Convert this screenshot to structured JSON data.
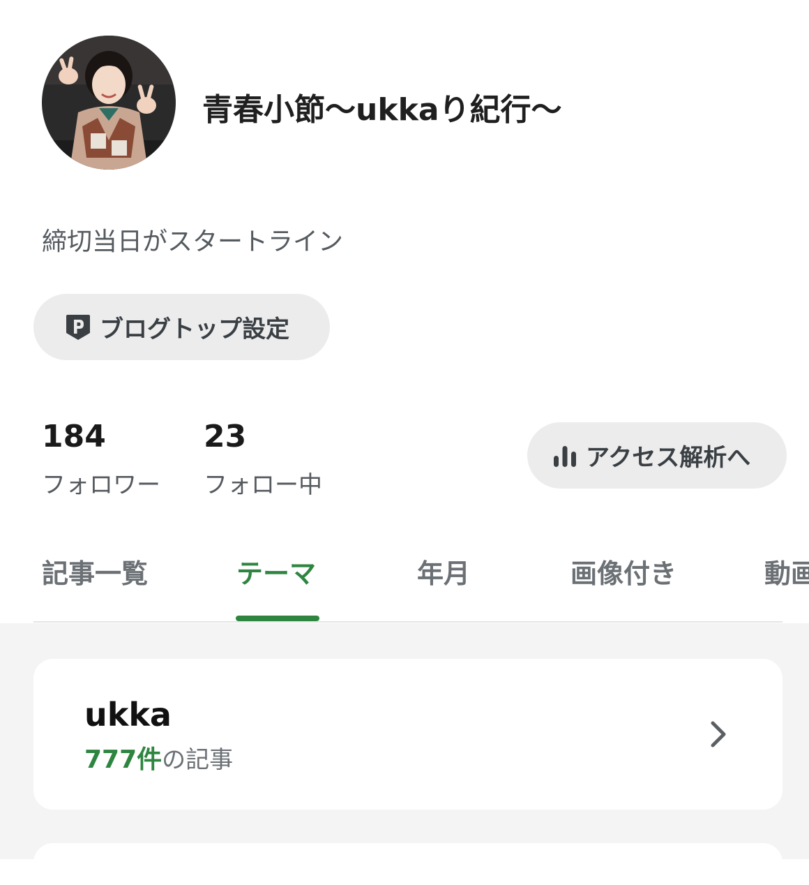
{
  "profile": {
    "blog_title": "青春小節〜ukkaり紀行〜",
    "description": "締切当日がスタートライン"
  },
  "blog_top_button": {
    "label": "ブログトップ設定",
    "icon": "p-badge-icon"
  },
  "stats": {
    "followers": {
      "value": "184",
      "label": "フォロワー"
    },
    "following": {
      "value": "23",
      "label": "フォロー中"
    }
  },
  "access_button": {
    "label": "アクセス解析へ",
    "icon": "bar-chart-icon"
  },
  "tabs": [
    {
      "label": "記事一覧",
      "active": false
    },
    {
      "label": "テーマ",
      "active": true
    },
    {
      "label": "年月",
      "active": false
    },
    {
      "label": "画像付き",
      "active": false
    },
    {
      "label": "動画",
      "active": false
    }
  ],
  "themes": [
    {
      "name": "ukka",
      "count": "777件",
      "count_suffix": "の記事"
    }
  ],
  "colors": {
    "accent": "#2e8540",
    "pill_bg": "#ececec",
    "list_bg": "#f4f4f4"
  }
}
